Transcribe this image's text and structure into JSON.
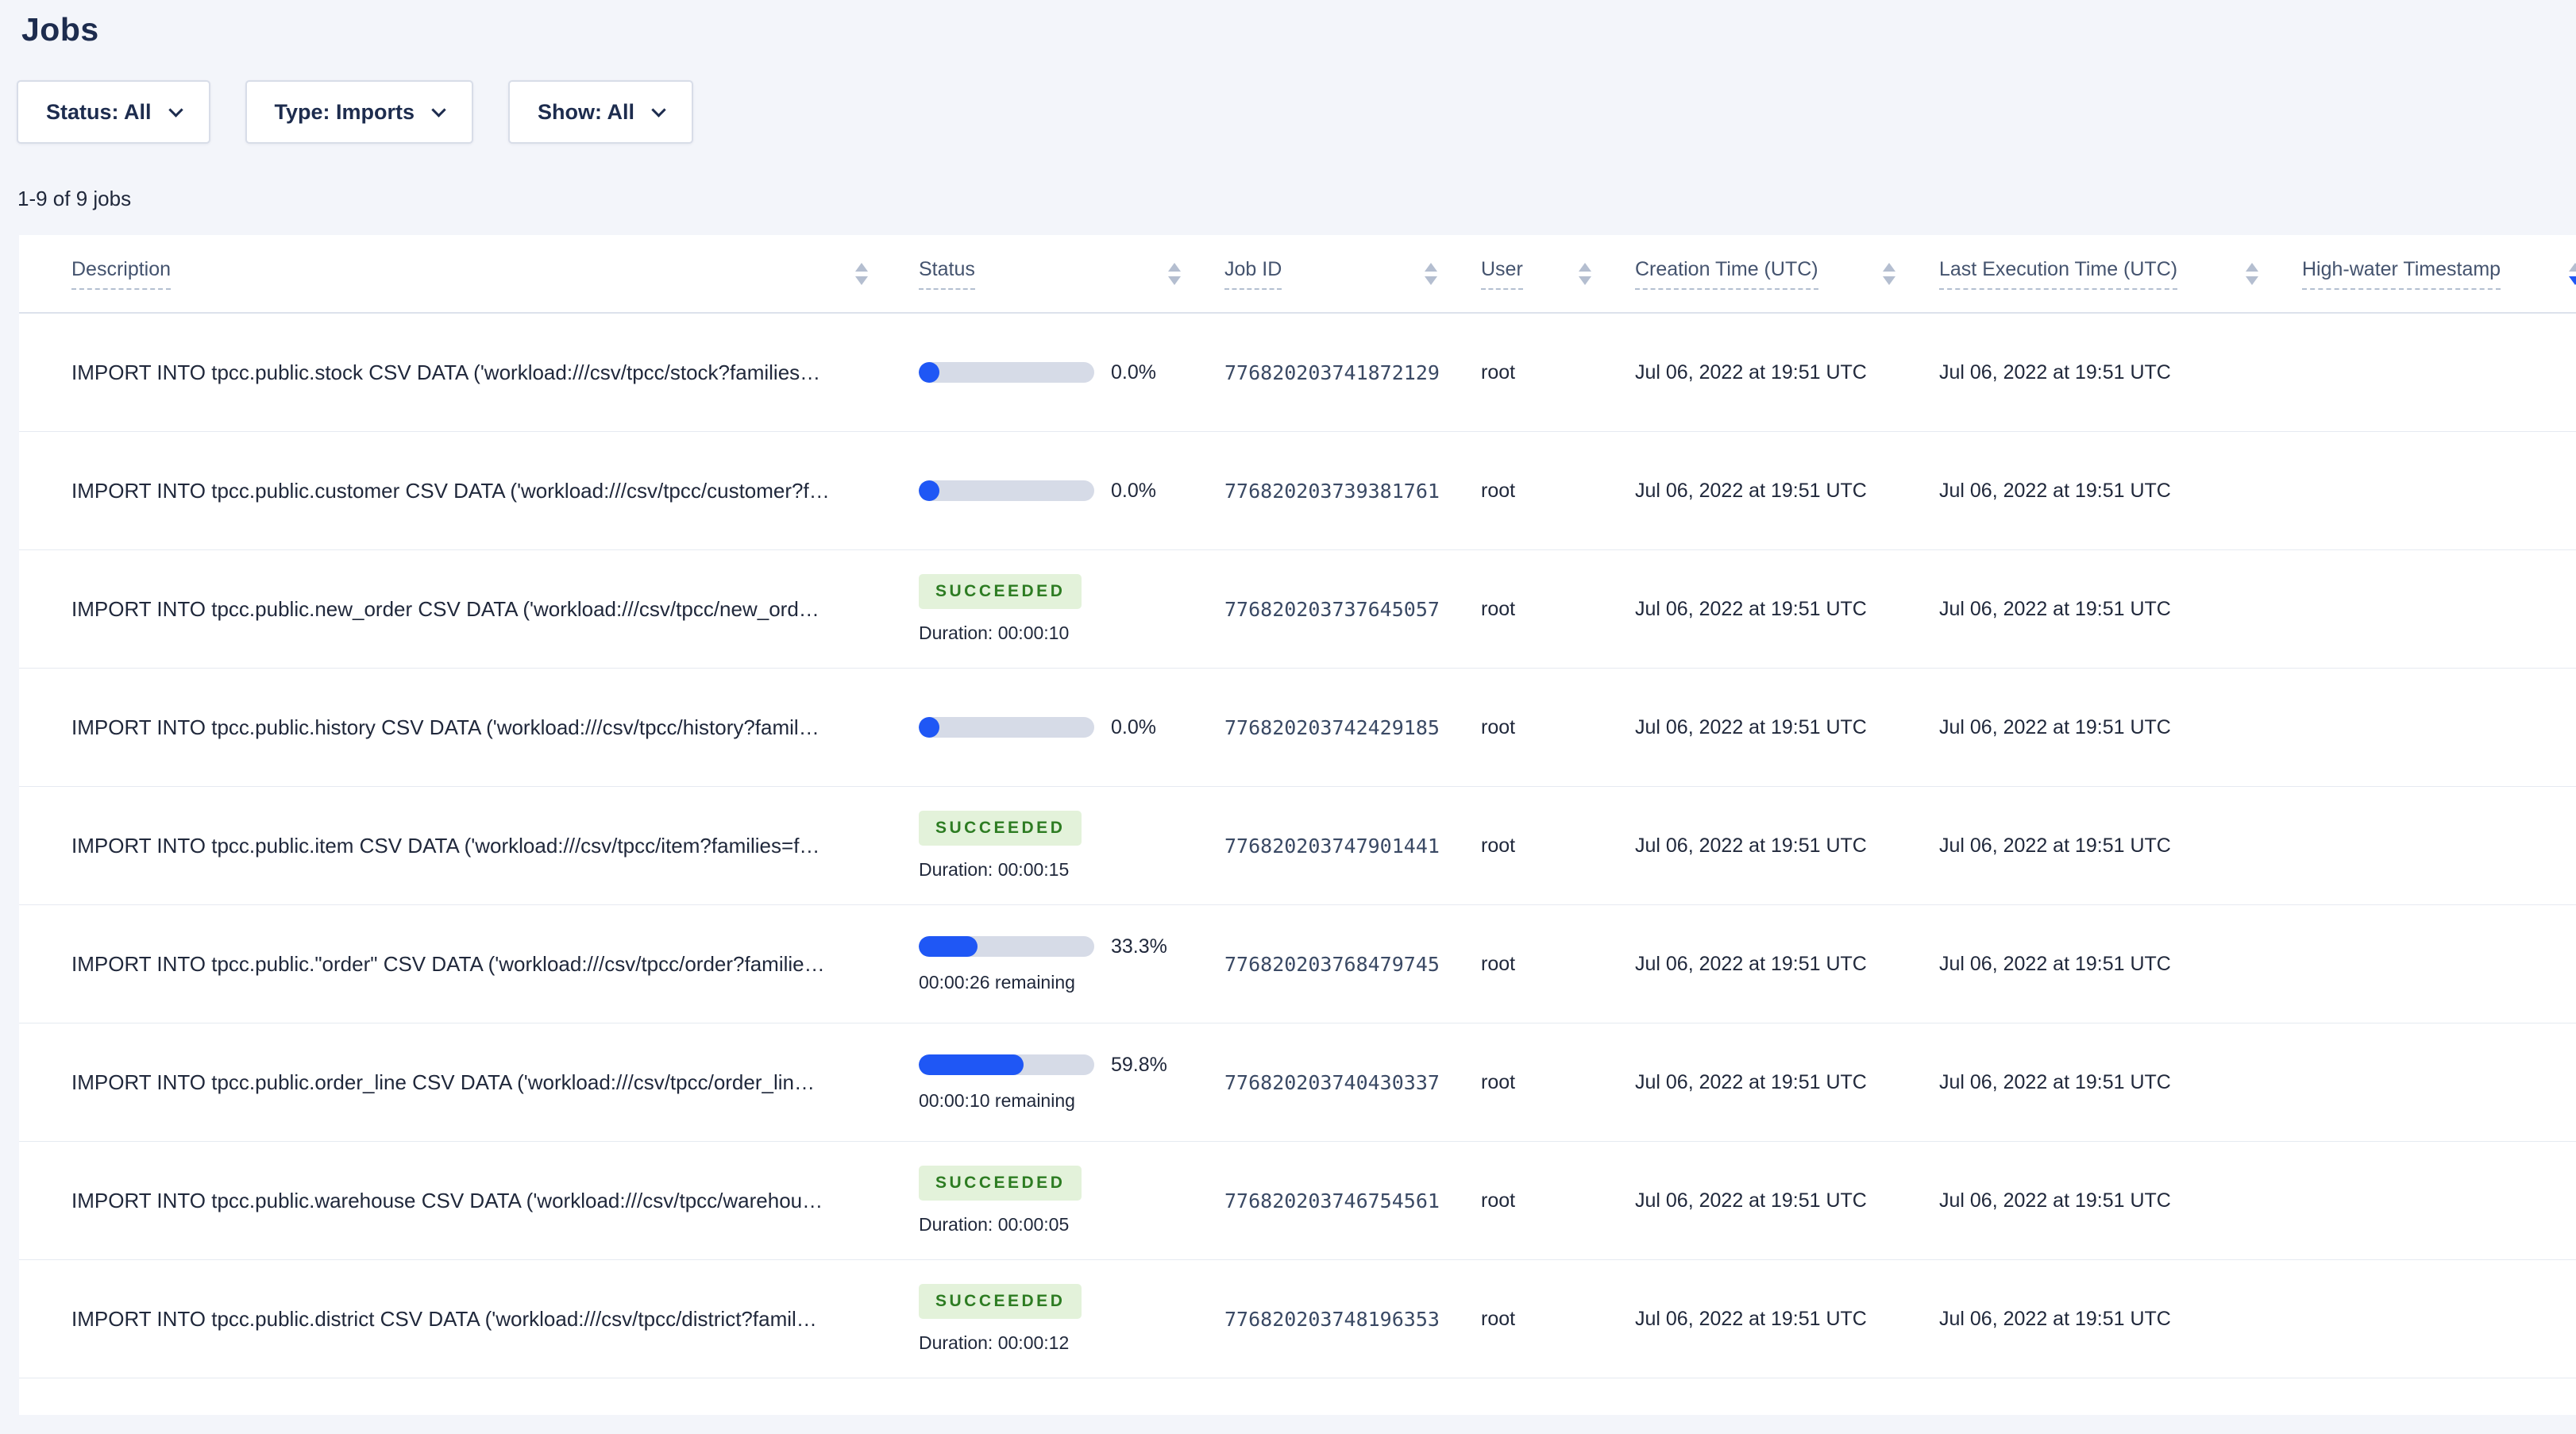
{
  "page": {
    "title": "Jobs",
    "jobs_count": "1-9 of 9 jobs"
  },
  "colors": {
    "accent_blue": "#1f57f5",
    "progress_track": "#d6dbe7",
    "succeeded_bg": "#e3f2da",
    "succeeded_text": "#2d7c22",
    "page_background": "#f3f5fa",
    "header_text": "#44536e",
    "body_text": "#20283b"
  },
  "filters": [
    {
      "label": "Status: All"
    },
    {
      "label": "Type: Imports"
    },
    {
      "label": "Show: All"
    }
  ],
  "table": {
    "columns": [
      {
        "label": "Description",
        "sort": "none"
      },
      {
        "label": "Status",
        "sort": "none"
      },
      {
        "label": "Job ID",
        "sort": "none"
      },
      {
        "label": "User",
        "sort": "none"
      },
      {
        "label": "Creation Time (UTC)",
        "sort": "none"
      },
      {
        "label": "Last Execution Time (UTC)",
        "sort": "none"
      },
      {
        "label": "High-water Timestamp",
        "sort": "desc"
      }
    ],
    "rows": [
      {
        "description": "IMPORT INTO tpcc.public.stock CSV DATA ('workload:///csv/tpcc/stock?families…",
        "status": {
          "kind": "progress",
          "percent": "0.0%",
          "fraction": 0,
          "sub": ""
        },
        "job_id": "776820203741872129",
        "user": "root",
        "creation_time": "Jul 06, 2022 at 19:51 UTC",
        "last_execution_time": "Jul 06, 2022 at 19:51 UTC",
        "high_water": ""
      },
      {
        "description": "IMPORT INTO tpcc.public.customer CSV DATA ('workload:///csv/tpcc/customer?f…",
        "status": {
          "kind": "progress",
          "percent": "0.0%",
          "fraction": 0,
          "sub": ""
        },
        "job_id": "776820203739381761",
        "user": "root",
        "creation_time": "Jul 06, 2022 at 19:51 UTC",
        "last_execution_time": "Jul 06, 2022 at 19:51 UTC",
        "high_water": ""
      },
      {
        "description": "IMPORT INTO tpcc.public.new_order CSV DATA ('workload:///csv/tpcc/new_ord…",
        "status": {
          "kind": "succeeded",
          "badge": "SUCCEEDED",
          "sub": "Duration: 00:00:10"
        },
        "job_id": "776820203737645057",
        "user": "root",
        "creation_time": "Jul 06, 2022 at 19:51 UTC",
        "last_execution_time": "Jul 06, 2022 at 19:51 UTC",
        "high_water": ""
      },
      {
        "description": "IMPORT INTO tpcc.public.history CSV DATA ('workload:///csv/tpcc/history?famil…",
        "status": {
          "kind": "progress",
          "percent": "0.0%",
          "fraction": 0,
          "sub": ""
        },
        "job_id": "776820203742429185",
        "user": "root",
        "creation_time": "Jul 06, 2022 at 19:51 UTC",
        "last_execution_time": "Jul 06, 2022 at 19:51 UTC",
        "high_water": ""
      },
      {
        "description": "IMPORT INTO tpcc.public.item CSV DATA ('workload:///csv/tpcc/item?families=f…",
        "status": {
          "kind": "succeeded",
          "badge": "SUCCEEDED",
          "sub": "Duration: 00:00:15"
        },
        "job_id": "776820203747901441",
        "user": "root",
        "creation_time": "Jul 06, 2022 at 19:51 UTC",
        "last_execution_time": "Jul 06, 2022 at 19:51 UTC",
        "high_water": ""
      },
      {
        "description": "IMPORT INTO tpcc.public.\"order\" CSV DATA ('workload:///csv/tpcc/order?familie…",
        "status": {
          "kind": "progress",
          "percent": "33.3%",
          "fraction": 0.333,
          "sub": "00:00:26 remaining"
        },
        "job_id": "776820203768479745",
        "user": "root",
        "creation_time": "Jul 06, 2022 at 19:51 UTC",
        "last_execution_time": "Jul 06, 2022 at 19:51 UTC",
        "high_water": ""
      },
      {
        "description": "IMPORT INTO tpcc.public.order_line CSV DATA ('workload:///csv/tpcc/order_lin…",
        "status": {
          "kind": "progress",
          "percent": "59.8%",
          "fraction": 0.598,
          "sub": "00:00:10 remaining"
        },
        "job_id": "776820203740430337",
        "user": "root",
        "creation_time": "Jul 06, 2022 at 19:51 UTC",
        "last_execution_time": "Jul 06, 2022 at 19:51 UTC",
        "high_water": ""
      },
      {
        "description": "IMPORT INTO tpcc.public.warehouse CSV DATA ('workload:///csv/tpcc/warehou…",
        "status": {
          "kind": "succeeded",
          "badge": "SUCCEEDED",
          "sub": "Duration: 00:00:05"
        },
        "job_id": "776820203746754561",
        "user": "root",
        "creation_time": "Jul 06, 2022 at 19:51 UTC",
        "last_execution_time": "Jul 06, 2022 at 19:51 UTC",
        "high_water": ""
      },
      {
        "description": "IMPORT INTO tpcc.public.district CSV DATA ('workload:///csv/tpcc/district?famil…",
        "status": {
          "kind": "succeeded",
          "badge": "SUCCEEDED",
          "sub": "Duration: 00:00:12"
        },
        "job_id": "776820203748196353",
        "user": "root",
        "creation_time": "Jul 06, 2022 at 19:51 UTC",
        "last_execution_time": "Jul 06, 2022 at 19:51 UTC",
        "high_water": ""
      }
    ]
  }
}
